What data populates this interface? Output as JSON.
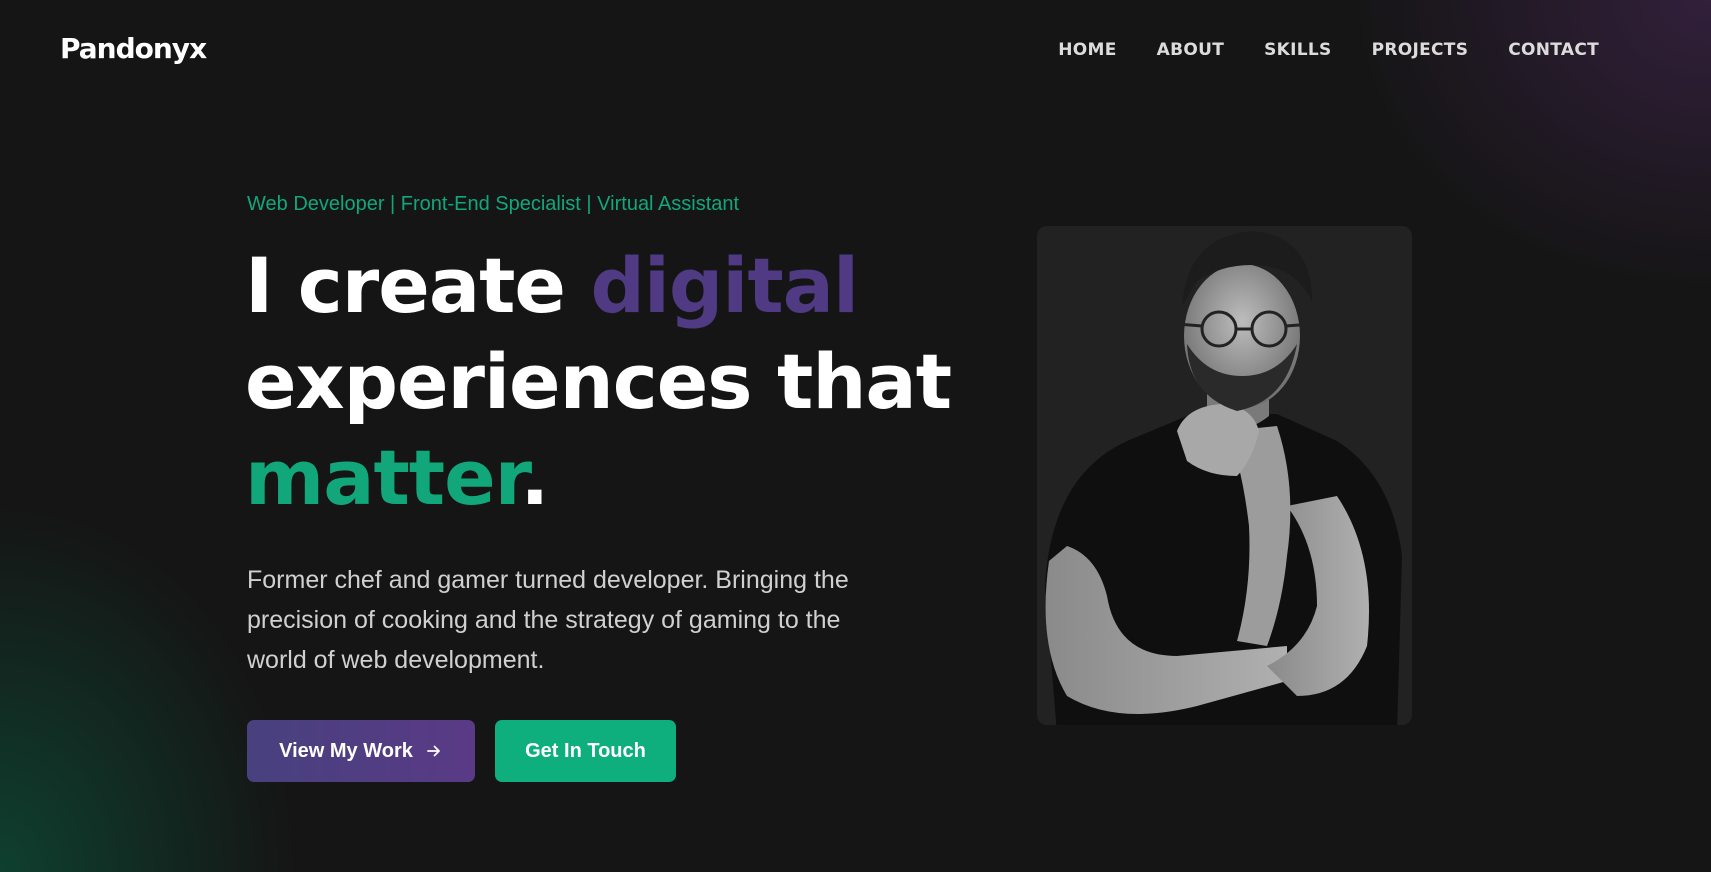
{
  "header": {
    "logo": "Pandonyx",
    "nav": [
      "HOME",
      "ABOUT",
      "SKILLS",
      "PROJECTS",
      "CONTACT"
    ]
  },
  "hero": {
    "tagline": "Web Developer | Front-End Specialist | Virtual Assistant",
    "headline": {
      "part1": "I create ",
      "highlight1": "digital",
      "part2": "experiences that",
      "highlight2": "matter",
      "end": "."
    },
    "description": "Former chef and gamer turned developer. Bringing the precision of cooking and the strategy of gaming to the world of web development.",
    "buttons": {
      "primary": "View My Work",
      "secondary": "Get In Touch"
    }
  },
  "colors": {
    "background": "#151515",
    "accent_green": "#12a77b",
    "accent_purple": "#4f3a83",
    "button_green": "#0fae7d"
  },
  "icons": {
    "primary_button_icon": "arrow-right-icon"
  }
}
